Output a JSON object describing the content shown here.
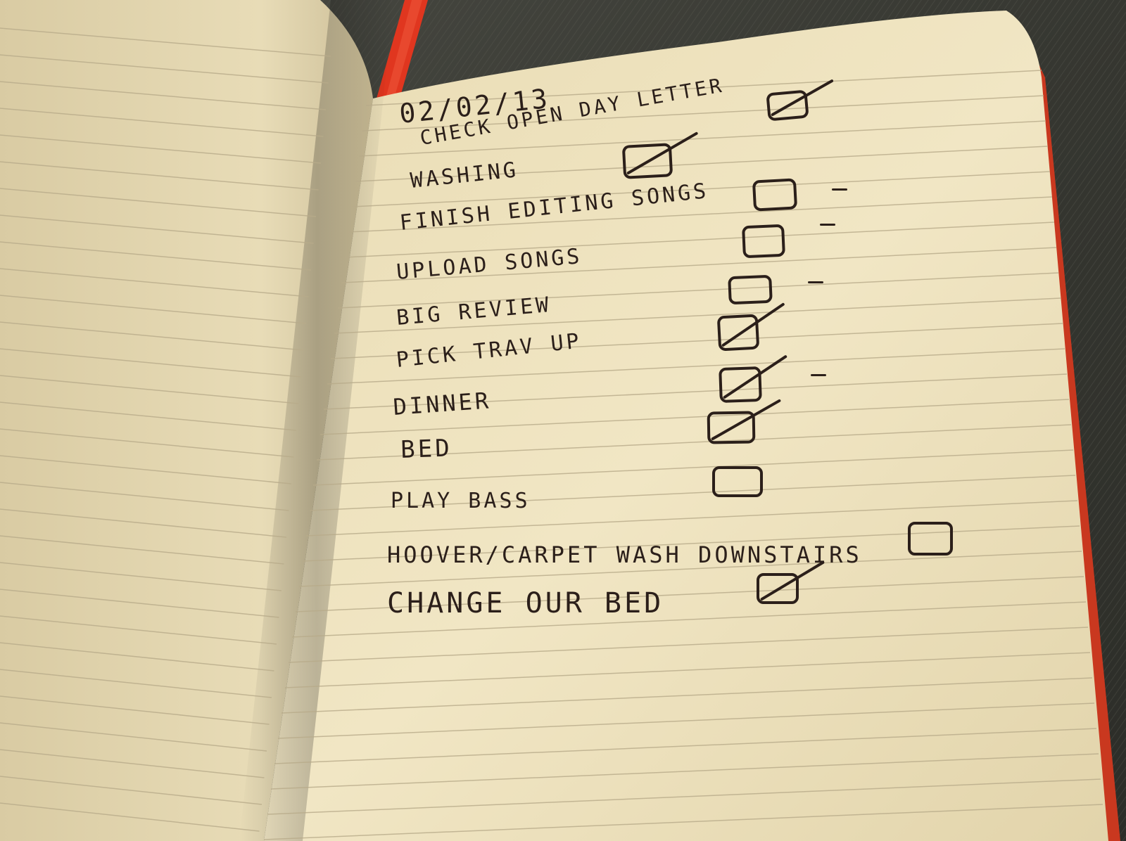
{
  "photo": {
    "fabric_color": "#3e3f38",
    "page_color": "#efe4c1",
    "ribbon_color": "#e0361f",
    "ink_color": "#2b1f1a"
  },
  "list": {
    "date": "02/02/13",
    "items": [
      {
        "text": "Check open day letter",
        "checked": true
      },
      {
        "text": "Washing",
        "checked": true
      },
      {
        "text": "Finish editing songs",
        "checked": false
      },
      {
        "text": "Upload songs",
        "checked": false
      },
      {
        "text": "Big review",
        "checked": false
      },
      {
        "text": "Pick Trav up",
        "checked": true
      },
      {
        "text": "Dinner",
        "checked": true
      },
      {
        "text": "Bed",
        "checked": true
      },
      {
        "text": "Play bass",
        "checked": false
      },
      {
        "text": "Hoover/carpet wash downstairs",
        "checked": false
      },
      {
        "text": "Change our bed",
        "checked": true
      }
    ]
  }
}
